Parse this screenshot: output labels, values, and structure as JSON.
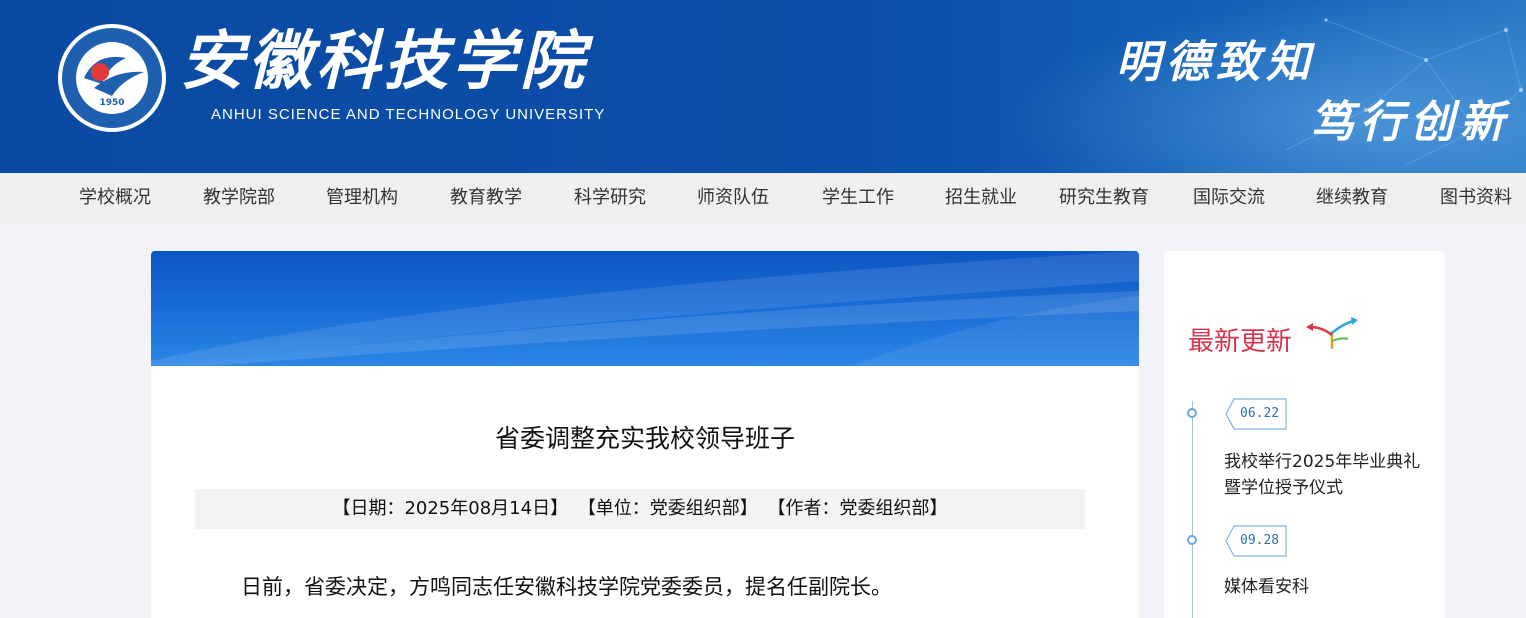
{
  "header": {
    "logo_cn": "安徽科技学院",
    "logo_en": "ANHUI SCIENCE AND TECHNOLOGY UNIVERSITY",
    "emblem_year": "1950",
    "motto_line1": "明德致知",
    "motto_line2": "笃行创新",
    "colors": {
      "primary": "#0b4ea9",
      "accent": "#2a7ac6"
    }
  },
  "nav": {
    "items": [
      {
        "label": "学校概况"
      },
      {
        "label": "教学院部"
      },
      {
        "label": "管理机构"
      },
      {
        "label": "教育教学"
      },
      {
        "label": "科学研究"
      },
      {
        "label": "师资队伍"
      },
      {
        "label": "学生工作"
      },
      {
        "label": "招生就业"
      },
      {
        "label": "研究生教育"
      },
      {
        "label": "国际交流"
      },
      {
        "label": "继续教育"
      },
      {
        "label": "图书资料"
      }
    ]
  },
  "article": {
    "title": "省委调整充实我校领导班子",
    "meta": {
      "date": "【日期：2025年08月14日】",
      "unit": "【单位：党委组织部】",
      "author": "【作者：党委组织部】"
    },
    "body": "日前，省委决定，方鸣同志任安徽科技学院党委委员，提名任副院长。"
  },
  "sidebar": {
    "heading": "最新更新",
    "heading_color": "#d6344b",
    "items": [
      {
        "date": "06.22",
        "title": "我校举行2025年毕业典礼暨学位授予仪式"
      },
      {
        "date": "09.28",
        "title": "媒体看安科"
      }
    ]
  }
}
